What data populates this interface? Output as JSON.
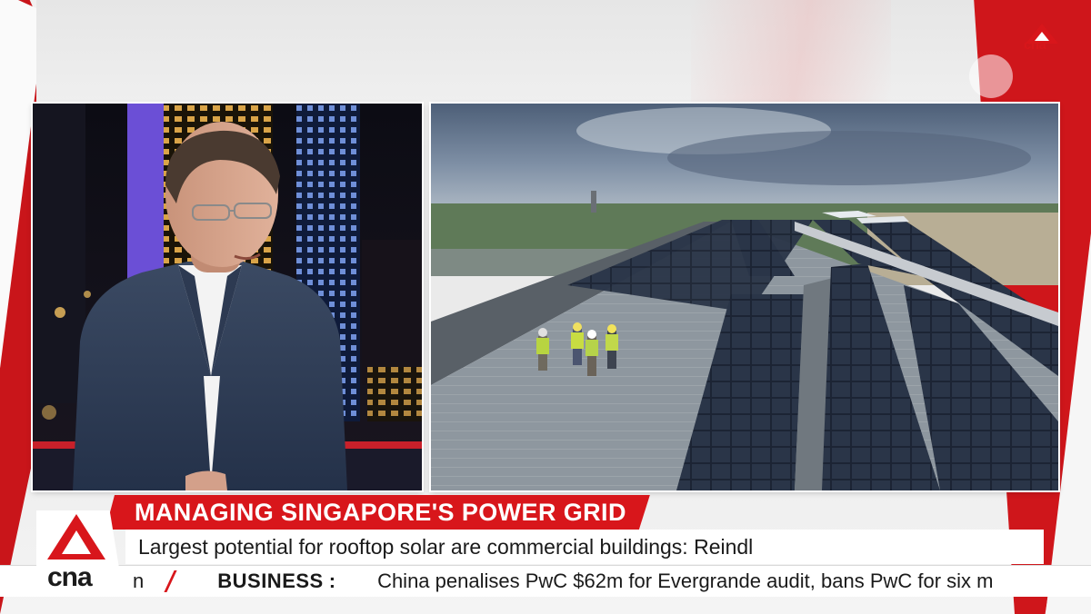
{
  "broadcast": {
    "headline": "MANAGING SINGAPORE'S POWER GRID",
    "subheadline": "Largest potential for rooftop solar are commercial buildings: Reindl"
  },
  "ticker": {
    "lead_fragment": "n",
    "category": "BUSINESS",
    "separator": ":",
    "story": "China penalises PwC $62m for Evergrande audit, bans PwC for six m"
  },
  "logos": {
    "main": "cna",
    "corner": "cna"
  },
  "colors": {
    "brand_red": "#d8161b",
    "ticker_divider": "#d8161b",
    "text_dark": "#1a1a1a"
  },
  "icons": {
    "logo_mark": "cna-a-triangle-logo",
    "watermark": "cna-watermark-icon"
  }
}
